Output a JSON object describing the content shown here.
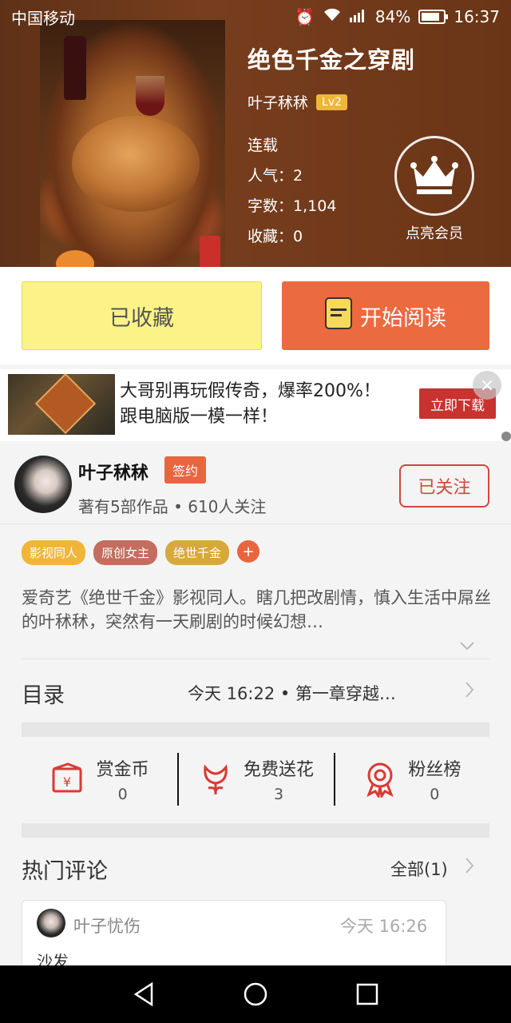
{
  "status": {
    "carrier": "中国移动",
    "battery": "84%",
    "time": "16:37"
  },
  "book": {
    "title": "绝色千金之穿剧",
    "author": "叶子秫秫",
    "author_level": "Lv2",
    "state": "连载",
    "popularity_label": "人气：",
    "popularity": "2",
    "words_label": "字数：",
    "words": "1,104",
    "favorites_label": "收藏：",
    "favorites": "0"
  },
  "vip": {
    "label": "点亮会员"
  },
  "actions": {
    "collected": "已收藏",
    "read": "开始阅读"
  },
  "ad": {
    "line1": "大哥别再玩假传奇，爆率200%！",
    "line2": "跟电脑版一模一样！",
    "button": "立即下载",
    "close": "×"
  },
  "author_section": {
    "name": "叶子秫秫",
    "badge": "签约",
    "subtitle": "著有5部作品 • 610人关注",
    "follow_button": "已关注"
  },
  "tags": [
    {
      "label": "影视同人",
      "color": "#f0b63a"
    },
    {
      "label": "原创女主",
      "color": "#c36e5e"
    },
    {
      "label": "绝世千金",
      "color": "#d7a93b"
    }
  ],
  "description": "爱奇艺《绝世千金》影视同人。瞎几把改剧情，慎入生活中屌丝的叶秫秫，突然有一天刷剧的时候幻想…",
  "catalog": {
    "title": "目录",
    "info": "今天 16:22 • 第一章穿越…"
  },
  "stats": [
    {
      "label": "赏金币",
      "value": "0",
      "icon": "reward-coin-icon"
    },
    {
      "label": "免费送花",
      "value": "3",
      "icon": "flower-icon"
    },
    {
      "label": "粉丝榜",
      "value": "0",
      "icon": "ribbon-medal-icon"
    }
  ],
  "comments": {
    "title": "热门评论",
    "all_label": "全部(1)",
    "items": [
      {
        "user": "叶子忧伤",
        "time": "今天 16:26",
        "text": "沙发"
      }
    ]
  },
  "colors": {
    "accent": "#ec6a3f",
    "collected_bg": "#fbf387",
    "follow": "#d2453c",
    "stat_icon": "#d93a34"
  }
}
